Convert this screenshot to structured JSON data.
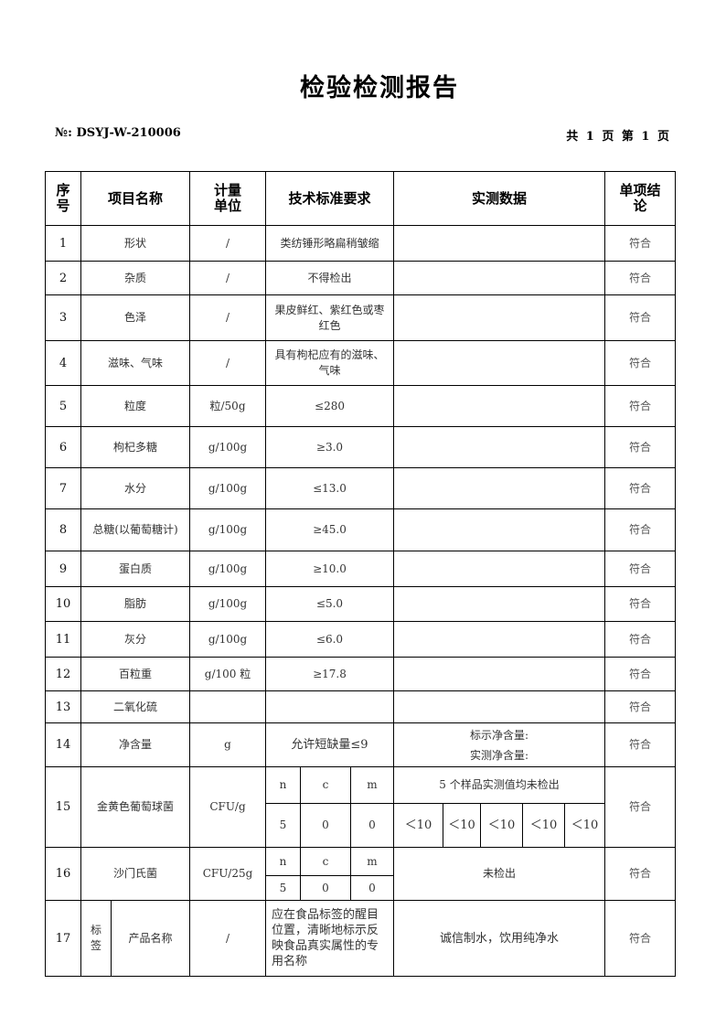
{
  "header": {
    "title": "检验检测报告",
    "doc_no": "№: DSYJ-W-210006",
    "pages": "共 1 页  第 1 页"
  },
  "table": {
    "columns": {
      "seq": "序号",
      "item": "项目名称",
      "unit": "计量单位",
      "standard": "技术标准要求",
      "measured": "实测数据",
      "conclusion": "单项结论"
    },
    "rows": [
      {
        "seq": "1",
        "item": "形状",
        "unit": "/",
        "standard": "类纺锤形略扁稍皱缩",
        "measured": "",
        "conclusion": "符合"
      },
      {
        "seq": "2",
        "item": "杂质",
        "unit": "/",
        "standard": "不得检出",
        "measured": "",
        "conclusion": "符合"
      },
      {
        "seq": "3",
        "item": "色泽",
        "unit": "/",
        "standard": "果皮鲜红、紫红色或枣红色",
        "measured": "",
        "conclusion": "符合"
      },
      {
        "seq": "4",
        "item": "滋味、气味",
        "unit": "/",
        "standard": "具有枸杞应有的滋味、气味",
        "measured": "",
        "conclusion": "符合"
      },
      {
        "seq": "5",
        "item": "粒度",
        "unit": "粒/50g",
        "standard": "≤280",
        "measured": "",
        "conclusion": "符合"
      },
      {
        "seq": "6",
        "item": "枸杞多糖",
        "unit": "g/100g",
        "standard": "≥3.0",
        "measured": "",
        "conclusion": "符合"
      },
      {
        "seq": "7",
        "item": "水分",
        "unit": "g/100g",
        "standard": "≤13.0",
        "measured": "",
        "conclusion": "符合"
      },
      {
        "seq": "8",
        "item": "总糖(以葡萄糖计)",
        "unit": "g/100g",
        "standard": "≥45.0",
        "measured": "",
        "conclusion": "符合"
      },
      {
        "seq": "9",
        "item": "蛋白质",
        "unit": "g/100g",
        "standard": "≥10.0",
        "measured": "",
        "conclusion": "符合"
      },
      {
        "seq": "10",
        "item": "脂肪",
        "unit": "g/100g",
        "standard": "≤5.0",
        "measured": "",
        "conclusion": "符合"
      },
      {
        "seq": "11",
        "item": "灰分",
        "unit": "g/100g",
        "standard": "≤6.0",
        "measured": "",
        "conclusion": "符合"
      },
      {
        "seq": "12",
        "item": "百粒重",
        "unit": "g/100 粒",
        "standard": "≥17.8",
        "measured": "",
        "conclusion": "符合"
      },
      {
        "seq": "13",
        "item": "二氧化硫",
        "unit": "",
        "standard": "",
        "measured": "",
        "conclusion": "符合"
      },
      {
        "seq": "14",
        "item": "净含量",
        "unit": "g",
        "standard": "允许短缺量≤9",
        "measured_line1": "标示净含量:",
        "measured_line2": "实测净含量:",
        "conclusion": "符合"
      }
    ],
    "row15": {
      "seq": "15",
      "item": "金黄色葡萄球菌",
      "unit": "CFU/g",
      "plan_headers": [
        "n",
        "c",
        "m"
      ],
      "plan_values": [
        "5",
        "0",
        "0"
      ],
      "measured_summary": "5 个样品实测值均未检出",
      "measured_values": [
        "＜10",
        "＜10",
        "＜10",
        "＜10",
        "＜10"
      ],
      "conclusion": "符合"
    },
    "row16": {
      "seq": "16",
      "item": "沙门氏菌",
      "unit": "CFU/25g",
      "plan_headers": [
        "n",
        "c",
        "m"
      ],
      "plan_values": [
        "5",
        "0",
        "0"
      ],
      "measured": "未检出",
      "conclusion": "符合"
    },
    "row17": {
      "seq": "17",
      "group": "标签",
      "item": "产品名称",
      "unit": "/",
      "standard": "应在食品标签的醒目位置，清晰地标示反映食品真实属性的专用名称",
      "measured": "诚信制水，饮用纯净水",
      "conclusion": "符合"
    }
  }
}
